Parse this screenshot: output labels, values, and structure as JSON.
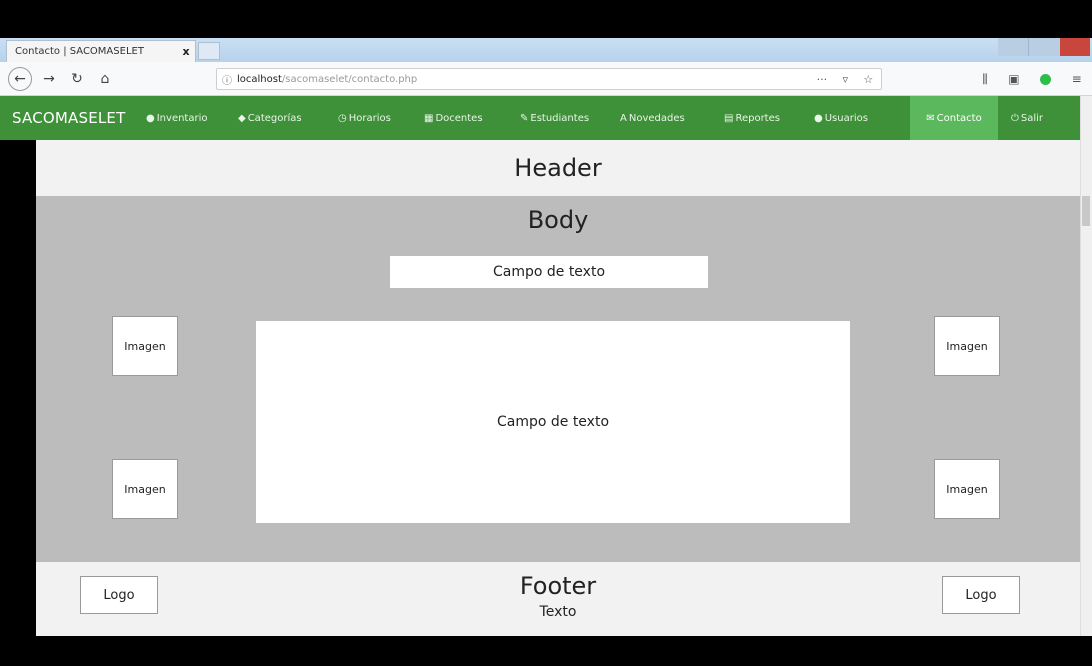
{
  "browser": {
    "tab_title": "Contacto | SACOMASELET",
    "tab_close": "x",
    "url_host": "localhost",
    "url_path": "/sacomaselet/contacto.php",
    "url_more": "···",
    "icons": [
      "back-icon",
      "forward-icon",
      "reload-icon",
      "home-icon",
      "info-icon",
      "page-actions-icon",
      "pocket-icon",
      "bookmark-star-icon",
      "library-icon",
      "sidebar-icon",
      "extension-icon",
      "menu-icon"
    ]
  },
  "nav": {
    "brand": "SACOMASELET",
    "items": [
      {
        "icon": "●",
        "label": "Inventario"
      },
      {
        "icon": "◆",
        "label": "Categorías"
      },
      {
        "icon": "◷",
        "label": "Horarios"
      },
      {
        "icon": "▦",
        "label": "Docentes"
      },
      {
        "icon": "✎",
        "label": "Estudiantes"
      },
      {
        "icon": "A",
        "label": "Novedades"
      },
      {
        "icon": "▤",
        "label": "Reportes"
      },
      {
        "icon": "●",
        "label": "Usuarios"
      },
      {
        "icon": "✉",
        "label": "Contacto"
      },
      {
        "icon": "⏻",
        "label": "Salir"
      }
    ],
    "colors": {
      "bar": "#3e9138",
      "active": "#5cb85c"
    }
  },
  "mockup": {
    "header": "Header",
    "body": "Body",
    "small_field": "Campo de texto",
    "large_field": "Campo de texto",
    "images": [
      "Imagen",
      "Imagen",
      "Imagen",
      "Imagen"
    ],
    "footer": "Footer",
    "footer_text": "Texto",
    "logos": [
      "Logo",
      "Logo"
    ]
  }
}
